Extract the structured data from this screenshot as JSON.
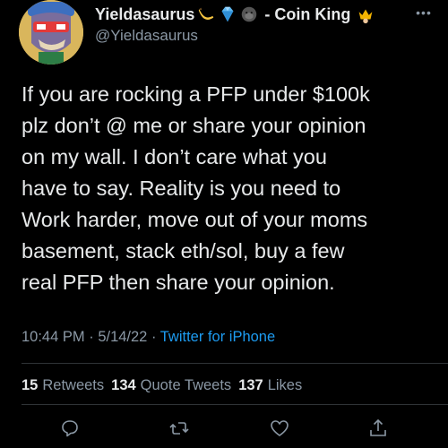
{
  "user": {
    "display_name": "Yieldasaurus",
    "name_suffix": "- Coin King",
    "handle": "@Yieldasaurus",
    "name_emojis": [
      "banana-emoji-icon",
      "gem-emoji-icon",
      "gorilla-emoji-icon"
    ],
    "suffix_emoji": "crown-emoji-icon"
  },
  "tweet": {
    "text": "If you are rocking a PFP under $100k\nplz don’t @ me or share your opinion\non my wall.  I don’t care what you\nhave to say. Reality is you need to\nWork harder, move out of your moms\nbasement, stack eth/sol, buy a few\nreal PFP then share your opinion.",
    "time": "10:44 PM",
    "separator": "·",
    "date": "5/14/22",
    "source": "Twitter for iPhone"
  },
  "stats": {
    "retweets_count": "15",
    "retweets_label": "Retweets",
    "quotes_count": "134",
    "quotes_label": "Quote Tweets",
    "likes_count": "137",
    "likes_label": "Likes"
  },
  "colors": {
    "background": "#000000",
    "text": "#e7e9ea",
    "secondary": "#8b98a5",
    "accent": "#1d9bf0",
    "divider": "#2f3336"
  }
}
